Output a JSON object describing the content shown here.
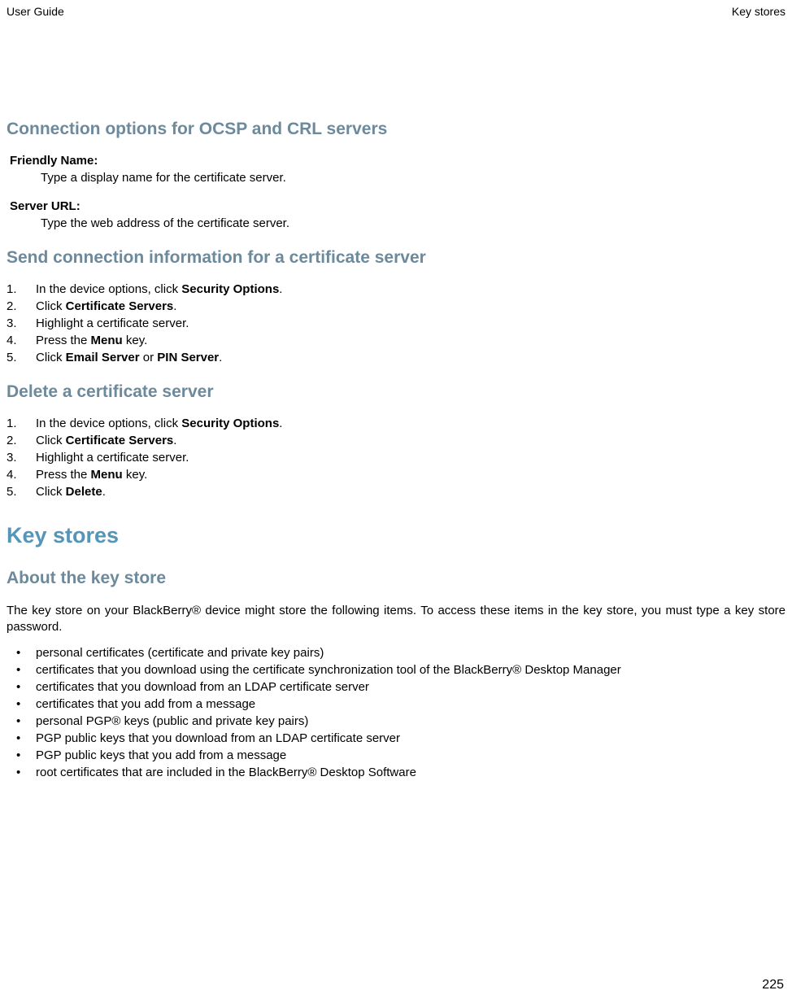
{
  "header": {
    "left": "User Guide",
    "right": "Key stores"
  },
  "section1": {
    "heading": "Connection options for OCSP and CRL servers",
    "def1": {
      "term": "Friendly Name:",
      "desc": "Type a display name for the certificate server."
    },
    "def2": {
      "term": "Server URL:",
      "desc": "Type the web address of the certificate server."
    }
  },
  "section2": {
    "heading": "Send connection information for a certificate server",
    "items": {
      "i1_pre": "In the device options, click ",
      "i1_bold": "Security Options",
      "i1_post": ".",
      "i2_pre": "Click ",
      "i2_bold": "Certificate Servers",
      "i2_post": ".",
      "i3": "Highlight a certificate server.",
      "i4_pre": "Press the ",
      "i4_bold": "Menu",
      "i4_post": " key.",
      "i5_pre": "Click ",
      "i5_bold1": "Email Server",
      "i5_mid": " or ",
      "i5_bold2": "PIN Server",
      "i5_post": "."
    }
  },
  "section3": {
    "heading": "Delete a certificate server",
    "items": {
      "i1_pre": "In the device options, click ",
      "i1_bold": "Security Options",
      "i1_post": ".",
      "i2_pre": "Click ",
      "i2_bold": "Certificate Servers",
      "i2_post": ".",
      "i3": "Highlight a certificate server.",
      "i4_pre": "Press the ",
      "i4_bold": "Menu",
      "i4_post": " key.",
      "i5_pre": "Click ",
      "i5_bold": "Delete",
      "i5_post": "."
    }
  },
  "section4": {
    "heading": "Key stores"
  },
  "section5": {
    "heading": "About the key store",
    "paragraph": "The key store on your BlackBerry® device might store the following items. To access these items in the key store, you must type a key store password.",
    "bullets": {
      "b1": "personal certificates (certificate and private key pairs)",
      "b2": "certificates that you download using the certificate synchronization tool of the BlackBerry® Desktop Manager",
      "b3": "certificates that you download from an LDAP certificate server",
      "b4": "certificates that you add from a message",
      "b5": "personal PGP® keys (public and private key pairs)",
      "b6": "PGP public keys that you download from an LDAP certificate server",
      "b7": "PGP public keys that you add from a message",
      "b8": "root certificates that are included in the BlackBerry® Desktop Software"
    }
  },
  "pageNumber": "225"
}
